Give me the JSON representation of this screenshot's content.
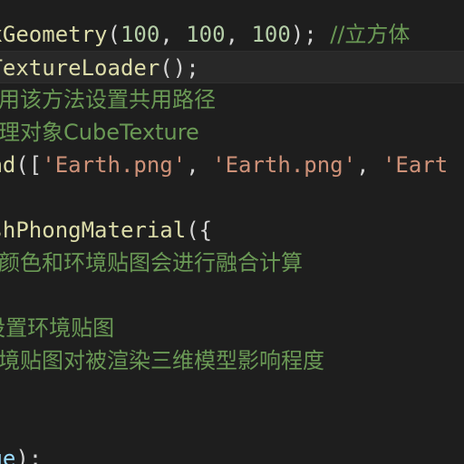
{
  "editor": {
    "theme_colors": {
      "background": "#1e1e1e",
      "function": "#dcdcaa",
      "number": "#b5cea8",
      "punctuation": "#d4d4d4",
      "string": "#ce9178",
      "comment": "#6a9955",
      "variable": "#9cdcfe"
    },
    "lines": [
      {
        "segments": [
          {
            "text": "oxGeometry",
            "kind": "fn"
          },
          {
            "text": "(",
            "kind": "punc"
          },
          {
            "text": "100",
            "kind": "num"
          },
          {
            "text": ", ",
            "kind": "punc"
          },
          {
            "text": "100",
            "kind": "num"
          },
          {
            "text": ", ",
            "kind": "punc"
          },
          {
            "text": "100",
            "kind": "num"
          },
          {
            "text": "); ",
            "kind": "punc"
          },
          {
            "text": "//立方体",
            "kind": "comment"
          }
        ]
      },
      {
        "current": true,
        "segments": [
          {
            "text": "eTextureLoader",
            "kind": "fn"
          },
          {
            "text": "();",
            "kind": "punc"
          }
        ]
      },
      {
        "segments": [
          {
            "text": "使用该方法设置共用路径",
            "kind": "comment"
          }
        ]
      },
      {
        "segments": [
          {
            "text": "纹理对象CubeTexture",
            "kind": "comment"
          }
        ]
      },
      {
        "segments": [
          {
            "text": "oad",
            "kind": "fn"
          },
          {
            "text": "([",
            "kind": "punc"
          },
          {
            "text": "'Earth.png'",
            "kind": "str"
          },
          {
            "text": ", ",
            "kind": "punc"
          },
          {
            "text": "'Earth.png'",
            "kind": "str"
          },
          {
            "text": ", ",
            "kind": "punc"
          },
          {
            "text": "'Eart",
            "kind": "str"
          }
        ]
      },
      {
        "segments": []
      },
      {
        "segments": [
          {
            "text": "eshPhongMaterial",
            "kind": "fn"
          },
          {
            "text": "({",
            "kind": "punc"
          }
        ]
      },
      {
        "segments": [
          {
            "text": "型颜色和环境贴图会进行融合计算",
            "kind": "comment"
          }
        ]
      },
      {
        "segments": []
      },
      {
        "segments": [
          {
            "text": "/设置环境贴图",
            "kind": "comment"
          }
        ]
      },
      {
        "segments": [
          {
            "text": "环境贴图对被渲染三维模型影响程度",
            "kind": "comment"
          }
        ]
      },
      {
        "segments": []
      },
      {
        "segments": []
      },
      {
        "segments": [
          {
            "text": "age",
            "kind": "var"
          },
          {
            "text": ");",
            "kind": "punc"
          }
        ]
      }
    ]
  }
}
